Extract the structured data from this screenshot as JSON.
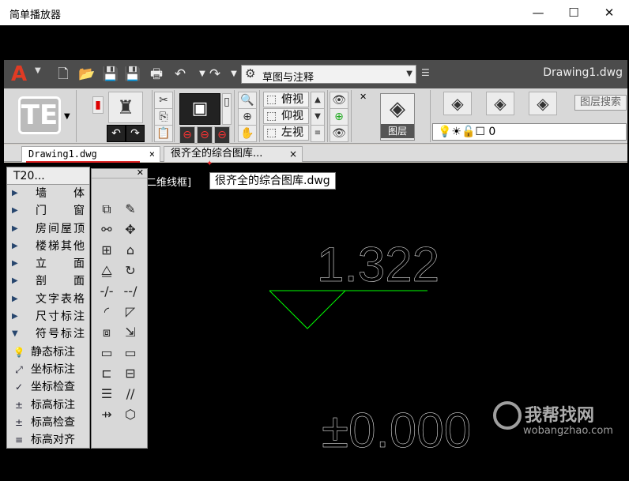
{
  "window": {
    "title": "简单播放器",
    "min": "—",
    "max": "☐",
    "close": "✕"
  },
  "qat": {
    "app_icon": "autocad-logo",
    "workspace": "草图与注释",
    "doc_title": "Drawing1.dwg",
    "icons": [
      "new-icon",
      "open-icon",
      "save-icon",
      "save-as-icon",
      "print-icon",
      "undo-icon",
      "redo-icon"
    ]
  },
  "ribbon": {
    "views": [
      "俯视",
      "仰视",
      "左视"
    ],
    "layers_label": "图层",
    "layer_search": "图层搜索",
    "current_layer": "0"
  },
  "tabs": [
    {
      "label": "Drawing1.dwg",
      "close": "×"
    },
    {
      "label": "很齐全的综合图库...",
      "close": "×"
    }
  ],
  "tooltip": "很齐全的综合图库.dwg",
  "viewport_label": "二维线框]",
  "t20": {
    "title": "T20...",
    "items": [
      "墙体",
      "门窗",
      "房间屋顶",
      "楼梯其他",
      "立面",
      "剖面",
      "文字表格",
      "尺寸标注",
      "符号标注"
    ],
    "subitems": [
      "静态标注",
      "坐标标注",
      "坐标检查",
      "标高标注",
      "标高检查",
      "标高对齐"
    ]
  },
  "drawing": {
    "elevation_text": "1.322",
    "base_text": "±0.000",
    "line_color": "#00ff00",
    "text_color": "#ffffff"
  },
  "watermark": {
    "brand": "我帮找网",
    "url": "wobangzhao.com"
  }
}
